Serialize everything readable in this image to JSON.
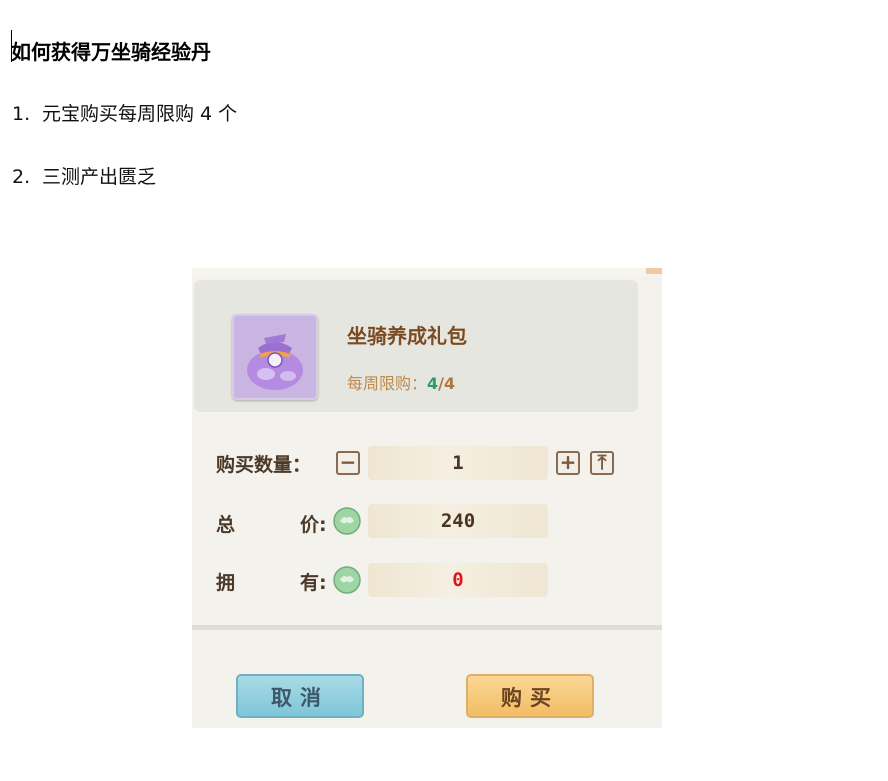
{
  "document": {
    "title": "如何获得万坐骑经验丹",
    "items": [
      {
        "num": "1.",
        "text": "元宝购买每周限购 4 个"
      },
      {
        "num": "2.",
        "text": "三测产出匮乏"
      }
    ]
  },
  "purchase_dialog": {
    "pack_name": "坐骑养成礼包",
    "weekly_limit_label": "每周限购：",
    "weekly_limit_current": "4",
    "weekly_limit_separator": "/",
    "weekly_limit_total": "4",
    "quantity_label": "购买数量：",
    "quantity_value": "1",
    "total_label_a": "总",
    "total_label_b": "价:",
    "total_value": "240",
    "owned_label_a": "拥",
    "owned_label_b": "有:",
    "owned_value": "0",
    "minus_symbol": "−",
    "plus_symbol": "+",
    "max_symbol": "⤒",
    "cancel_label": "取消",
    "buy_label": "购买",
    "colors": {
      "owned_value": "#e0141c",
      "limit_current": "#2f9a6a",
      "cancel_bg": "#7ec6d8",
      "buy_bg": "#f2bd64"
    },
    "icons": {
      "item": "purple-gift-bag-icon",
      "currency": "jade-coin-icon"
    }
  }
}
